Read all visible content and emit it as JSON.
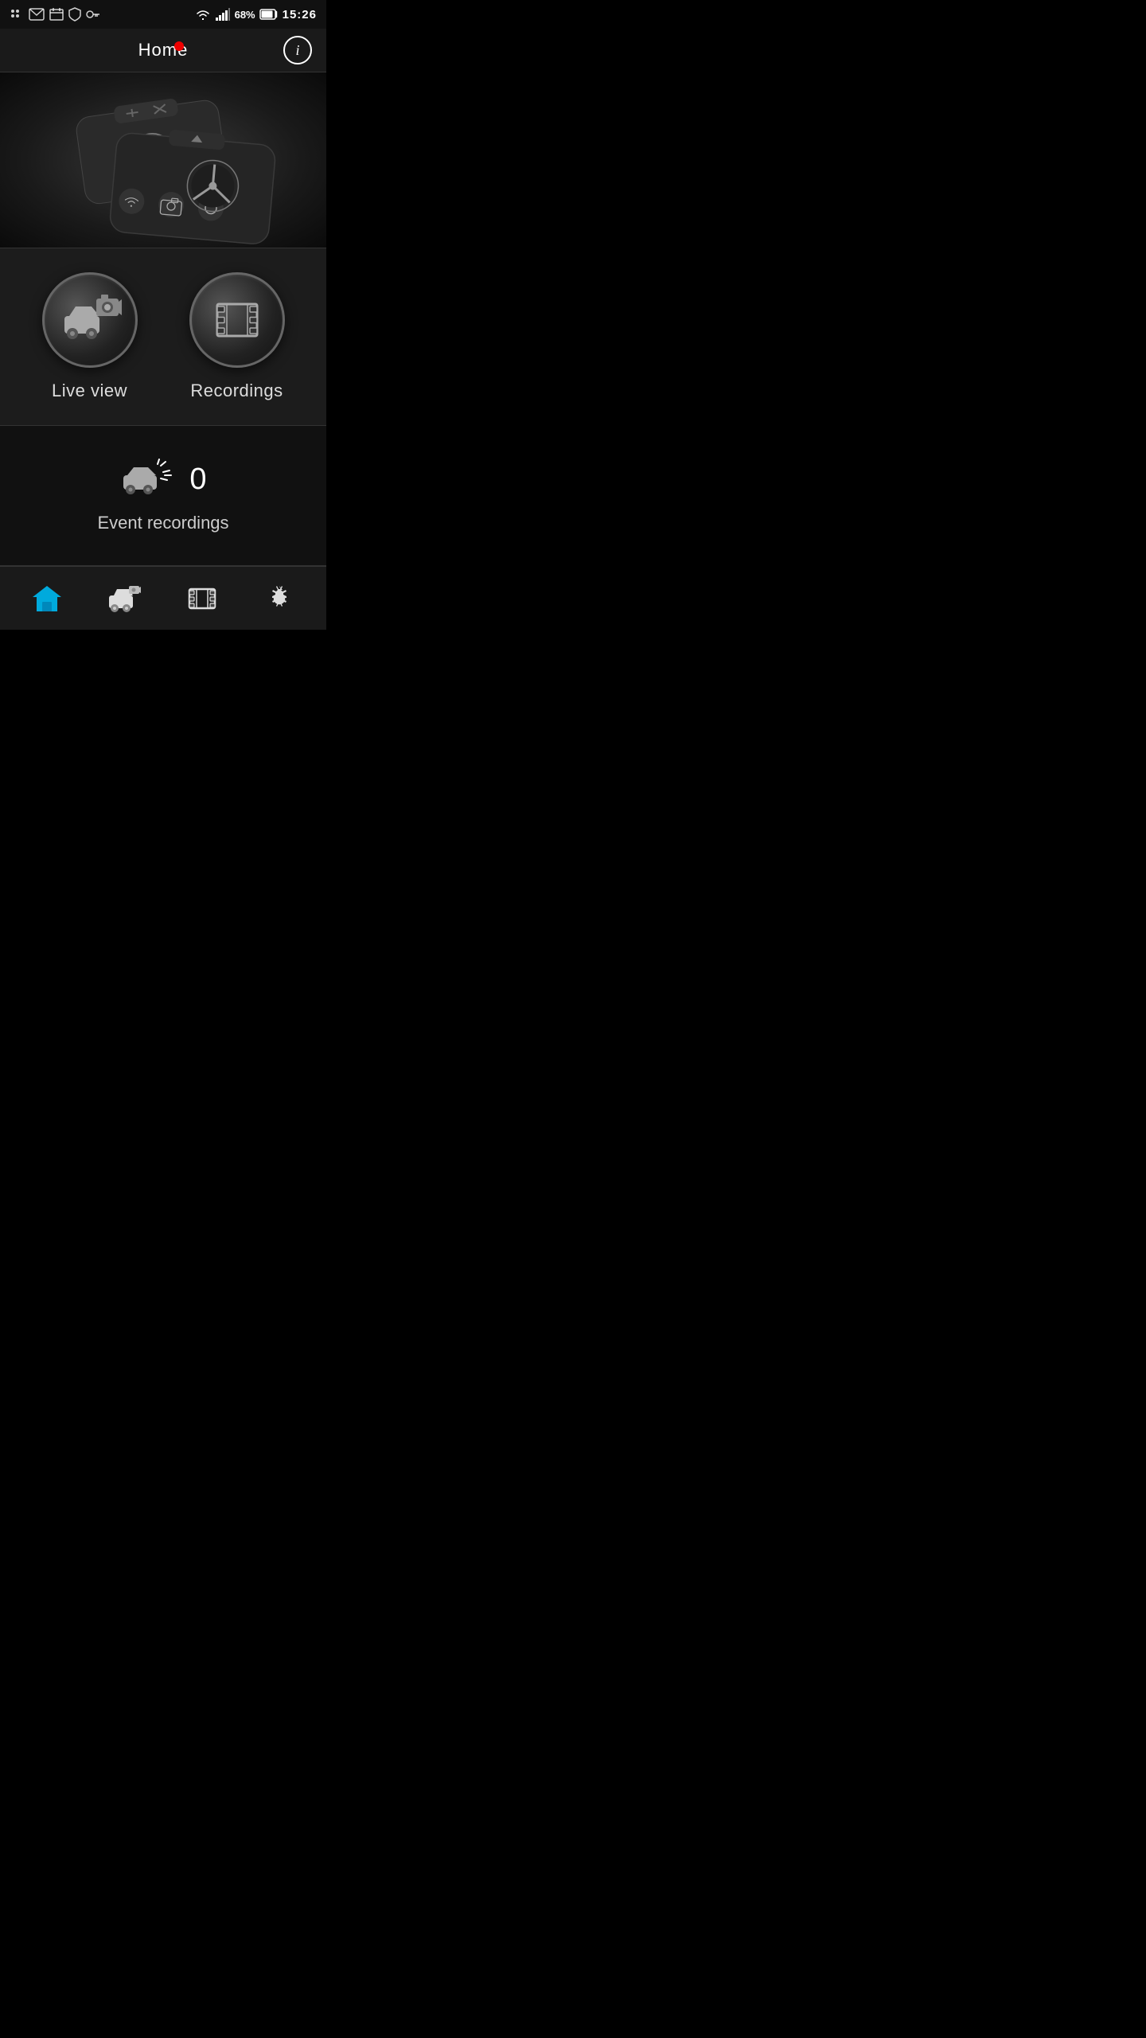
{
  "statusBar": {
    "battery": "68%",
    "time": "15:26"
  },
  "header": {
    "title": "Home",
    "infoLabel": "i"
  },
  "buttons": [
    {
      "id": "live-view",
      "label": "Live view",
      "icon": "live-view-icon"
    },
    {
      "id": "recordings",
      "label": "Recordings",
      "icon": "recordings-icon"
    }
  ],
  "eventSection": {
    "count": "0",
    "label": "Event recordings"
  },
  "bottomNav": [
    {
      "id": "home",
      "icon": "home-icon",
      "active": true
    },
    {
      "id": "live-view-nav",
      "icon": "live-view-nav-icon",
      "active": false
    },
    {
      "id": "recordings-nav",
      "icon": "recordings-nav-icon",
      "active": false
    },
    {
      "id": "settings-nav",
      "icon": "settings-nav-icon",
      "active": false
    }
  ]
}
